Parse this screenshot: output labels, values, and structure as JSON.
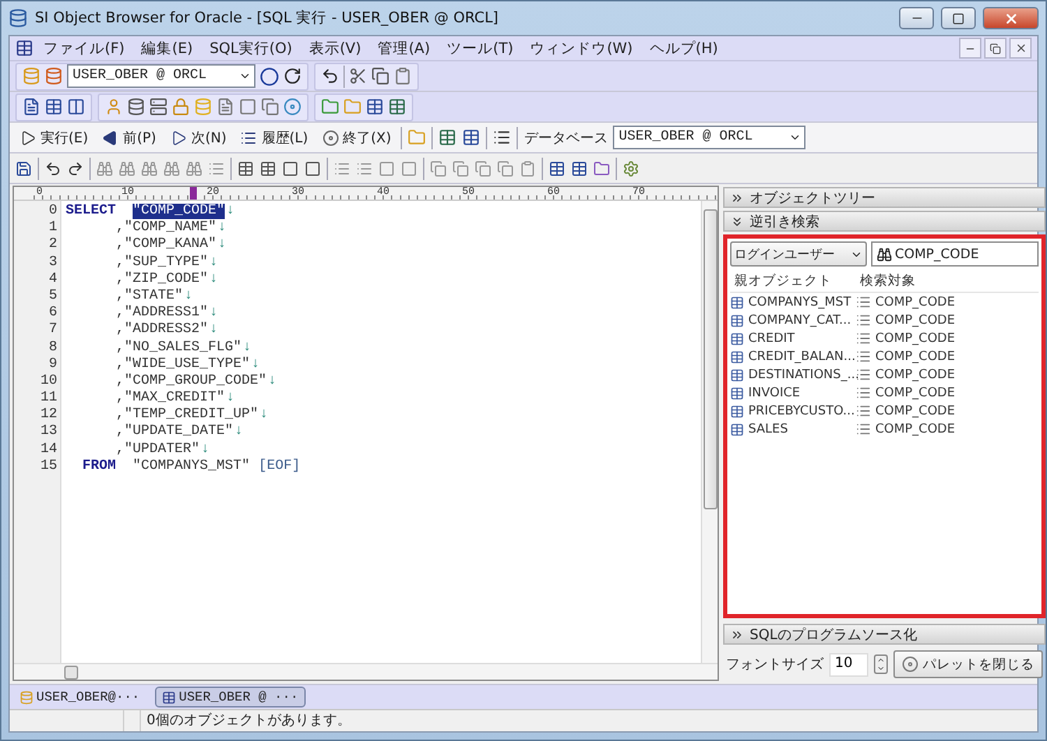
{
  "window": {
    "title": "SI Object Browser for Oracle - [SQL 実行 - USER_OBER @ ORCL]"
  },
  "menu": [
    {
      "label": "ファイル(F)"
    },
    {
      "label": "編集(E)"
    },
    {
      "label": "SQL実行(O)"
    },
    {
      "label": "表示(V)"
    },
    {
      "label": "管理(A)"
    },
    {
      "label": "ツール(T)"
    },
    {
      "label": "ウィンドウ(W)"
    },
    {
      "label": "ヘルプ(H)"
    }
  ],
  "connection": {
    "value": "USER_OBER @ ORCL"
  },
  "exec_toolbar": {
    "buttons": [
      {
        "label": "実行(E)",
        "kind": "run"
      },
      {
        "label": "前(P)",
        "kind": "prev"
      },
      {
        "label": "次(N)",
        "kind": "next"
      },
      {
        "label": "履歴(L)",
        "kind": "history"
      },
      {
        "label": "終了(X)",
        "kind": "stop"
      }
    ],
    "database_label": "データベース",
    "database_value": "USER_OBER @ ORCL"
  },
  "editor": {
    "ruler": [
      "0",
      "10",
      "20",
      "30",
      "40",
      "50",
      "60",
      "70"
    ],
    "lines": [
      {
        "number": "0",
        "kind": "select",
        "keyword": "SELECT",
        "text": "\"COMP_CODE\"",
        "selected": true,
        "end": "↓"
      },
      {
        "number": "1",
        "kind": "column",
        "text": ",\"COMP_NAME\"",
        "selected": false,
        "end": "↓"
      },
      {
        "number": "2",
        "kind": "column",
        "text": ",\"COMP_KANA\"",
        "selected": false,
        "end": "↓"
      },
      {
        "number": "3",
        "kind": "column",
        "text": ",\"SUP_TYPE\"",
        "selected": false,
        "end": "↓"
      },
      {
        "number": "4",
        "kind": "column",
        "text": ",\"ZIP_CODE\"",
        "selected": false,
        "end": "↓"
      },
      {
        "number": "5",
        "kind": "column",
        "text": ",\"STATE\"",
        "selected": false,
        "end": "↓"
      },
      {
        "number": "6",
        "kind": "column",
        "text": ",\"ADDRESS1\"",
        "selected": false,
        "end": "↓"
      },
      {
        "number": "7",
        "kind": "column",
        "text": ",\"ADDRESS2\"",
        "selected": false,
        "end": "↓"
      },
      {
        "number": "8",
        "kind": "column",
        "text": ",\"NO_SALES_FLG\"",
        "selected": false,
        "end": "↓"
      },
      {
        "number": "9",
        "kind": "column",
        "text": ",\"WIDE_USE_TYPE\"",
        "selected": false,
        "end": "↓"
      },
      {
        "number": "10",
        "kind": "column",
        "text": ",\"COMP_GROUP_CODE\"",
        "selected": false,
        "end": "↓"
      },
      {
        "number": "11",
        "kind": "column",
        "text": ",\"MAX_CREDIT\"",
        "selected": false,
        "end": "↓"
      },
      {
        "number": "12",
        "kind": "column",
        "text": ",\"TEMP_CREDIT_UP\"",
        "selected": false,
        "end": "↓"
      },
      {
        "number": "13",
        "kind": "column",
        "text": ",\"UPDATE_DATE\"",
        "selected": false,
        "end": "↓"
      },
      {
        "number": "14",
        "kind": "column",
        "text": ",\"UPDATER\"",
        "selected": false,
        "end": "↓"
      },
      {
        "number": "15",
        "kind": "from",
        "keyword": "FROM",
        "text": "\"COMPANYS_MST\"",
        "selected": false,
        "end": "[EOF]"
      }
    ]
  },
  "side_panel": {
    "sections": [
      {
        "label": "オブジェクトツリー",
        "expanded": false
      },
      {
        "label": "逆引き検索",
        "expanded": true
      }
    ],
    "scope": "ログインユーザー",
    "search": "COMP_CODE",
    "columns": [
      "親オブジェクト",
      "検索対象"
    ],
    "rows": [
      {
        "object": "COMPANYS_MST",
        "target": "COMP_CODE"
      },
      {
        "object": "COMPANY_CAT...",
        "target": "COMP_CODE"
      },
      {
        "object": "CREDIT",
        "target": "COMP_CODE"
      },
      {
        "object": "CREDIT_BALAN...",
        "target": "COMP_CODE"
      },
      {
        "object": "DESTINATIONS_...",
        "target": "COMP_CODE"
      },
      {
        "object": "INVOICE",
        "target": "COMP_CODE"
      },
      {
        "object": "PRICEBYCUSTO...",
        "target": "COMP_CODE"
      },
      {
        "object": "SALES",
        "target": "COMP_CODE"
      }
    ],
    "bottom_section": {
      "label": "SQLのプログラムソース化",
      "expanded": false
    },
    "font_size_label": "フォントサイズ",
    "font_size": "10",
    "close_button": "パレットを閉じる"
  },
  "tabs": [
    {
      "label": "USER_OBER@···",
      "selected": false,
      "kind": "db"
    },
    {
      "label": "USER_OBER @ ···",
      "selected": true,
      "kind": "sql"
    }
  ],
  "status_bar": {
    "message": "0個のオブジェクトがあります。"
  }
}
